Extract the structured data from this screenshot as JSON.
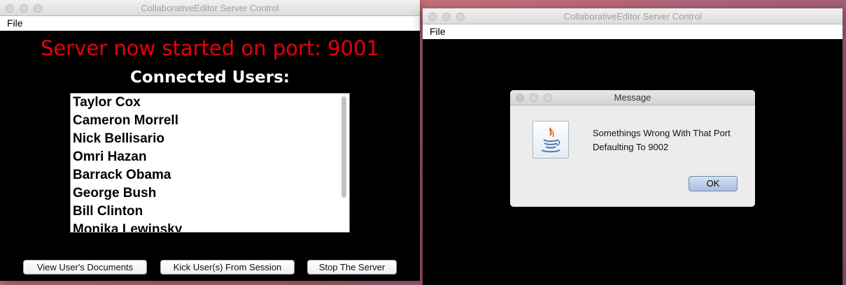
{
  "left_window": {
    "title": "CollaborativeEditor Server Control",
    "menu": {
      "file": "File"
    },
    "status_text": "Server now started on port: 9001",
    "users_heading": "Connected Users:",
    "users": [
      "Taylor Cox",
      "Cameron Morrell",
      "Nick Bellisario",
      "Omri Hazan",
      "Barrack Obama",
      "George Bush",
      "Bill Clinton",
      "Monika Lewinsky"
    ],
    "buttons": {
      "view_docs": "View User's Documents",
      "kick_users": "Kick User(s) From Session",
      "stop_server": "Stop The Server"
    }
  },
  "right_window": {
    "title": "CollaborativeEditor Server Control",
    "menu": {
      "file": "File"
    },
    "dialog": {
      "title": "Message",
      "line1": "Somethings Wrong With That Port",
      "line2": "Defaulting To 9002",
      "ok_label": "OK",
      "icon": "java-icon"
    }
  },
  "colors": {
    "status_red": "#e8000a",
    "content_bg": "#000000"
  }
}
